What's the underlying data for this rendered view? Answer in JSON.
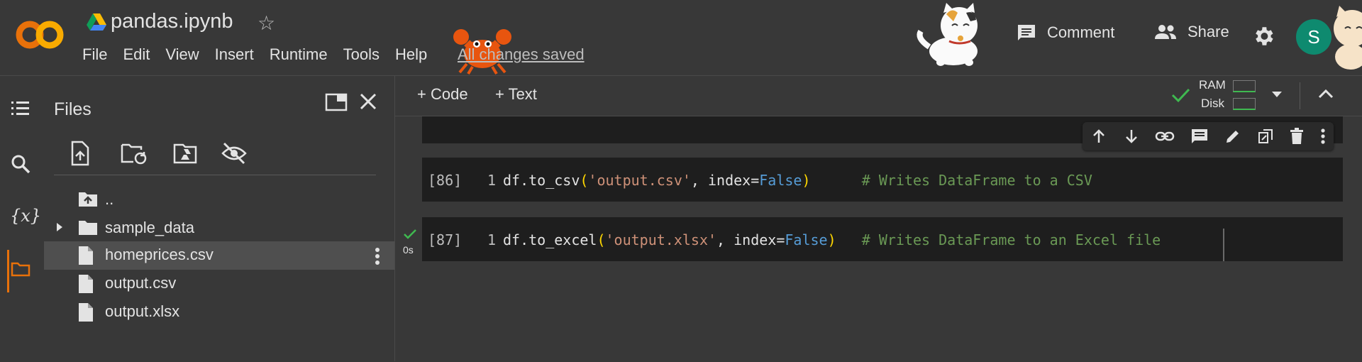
{
  "app": {
    "notebook_title": "pandas.ipynb",
    "menu": [
      "File",
      "Edit",
      "View",
      "Insert",
      "Runtime",
      "Tools",
      "Help"
    ],
    "save_status": "All changes saved",
    "comment_label": "Comment",
    "share_label": "Share",
    "avatar_letter": "S",
    "brand_color": "#f9ab00",
    "accent_color": "#e8710a"
  },
  "rail": {
    "icons": [
      "toc-icon",
      "search-icon",
      "variables-icon",
      "folder-icon"
    ],
    "variables_label": "{x}"
  },
  "files": {
    "title": "Files",
    "items": [
      {
        "label": "..",
        "type": "parent"
      },
      {
        "label": "sample_data",
        "type": "folder"
      },
      {
        "label": "homeprices.csv",
        "type": "file",
        "selected": true
      },
      {
        "label": "output.csv",
        "type": "file"
      },
      {
        "label": "output.xlsx",
        "type": "file"
      }
    ]
  },
  "toolbar": {
    "add_code": "+ Code",
    "add_text": "+ Text",
    "ram_label": "RAM",
    "disk_label": "Disk"
  },
  "cells": [
    {
      "exec_count": "[86]",
      "line": "1",
      "code_prefix": "df.to_csv",
      "open": "(",
      "str": "'output.csv'",
      "mid": ", index=",
      "kw": "False",
      "close": ")",
      "comment": "# Writes DataFrame to a CSV"
    },
    {
      "exec_count": "[87]",
      "line": "1",
      "code_prefix": "df.to_excel",
      "open": "(",
      "str": "'output.xlsx'",
      "mid": ", index=",
      "kw": "False",
      "close": ")",
      "comment": "# Writes DataFrame to an Excel file",
      "exec_time": "0s"
    }
  ]
}
